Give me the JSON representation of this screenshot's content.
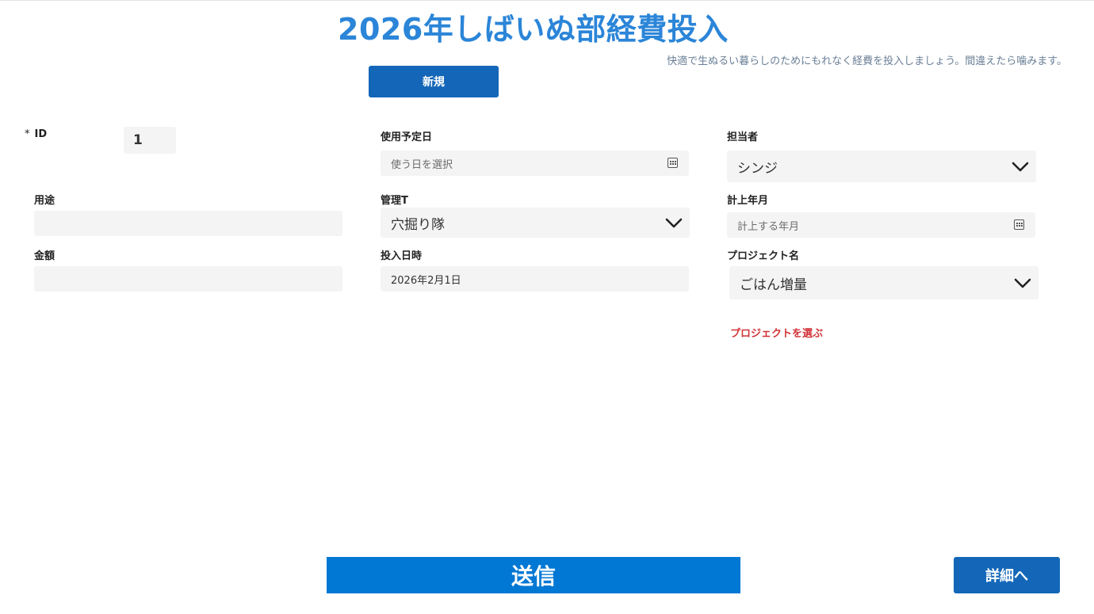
{
  "header": {
    "title": "2026年しばいぬ部経費投入",
    "subtitle": "快適で生ぬるい暮らしのためにもれなく経費を投入しましょう。間違えたら噛みます。",
    "new_button": "新規"
  },
  "form": {
    "id": {
      "required_mark": "*",
      "label": "ID",
      "value": "1"
    },
    "usage": {
      "label": "用途",
      "value": ""
    },
    "amount": {
      "label": "金額",
      "value": ""
    },
    "use_date": {
      "label": "使用予定日",
      "placeholder": "使う日を選択",
      "icon": "calendar-icon"
    },
    "team": {
      "label": "管理T",
      "selected": "穴掘り隊",
      "icon": "chevron-down-icon"
    },
    "input_datetime": {
      "label": "投入日時",
      "value": "2026年2月1日"
    },
    "owner": {
      "label": "担当者",
      "selected": "シンジ",
      "icon": "chevron-down-icon"
    },
    "booking_month": {
      "label": "計上年月",
      "placeholder": "計上する年月",
      "icon": "calendar-icon"
    },
    "project": {
      "label": "プロジェクト名",
      "selected": "ごはん増量",
      "icon": "chevron-down-icon"
    },
    "project_hint": "プロジェクトを選ぶ"
  },
  "footer": {
    "submit_button": "送信",
    "detail_button": "詳細へ"
  },
  "colors": {
    "title": "#2b85d8",
    "primary_button": "#1467b8",
    "submit_button": "#0078d4",
    "field_bg": "#f4f4f4",
    "error_text": "#d13438"
  }
}
